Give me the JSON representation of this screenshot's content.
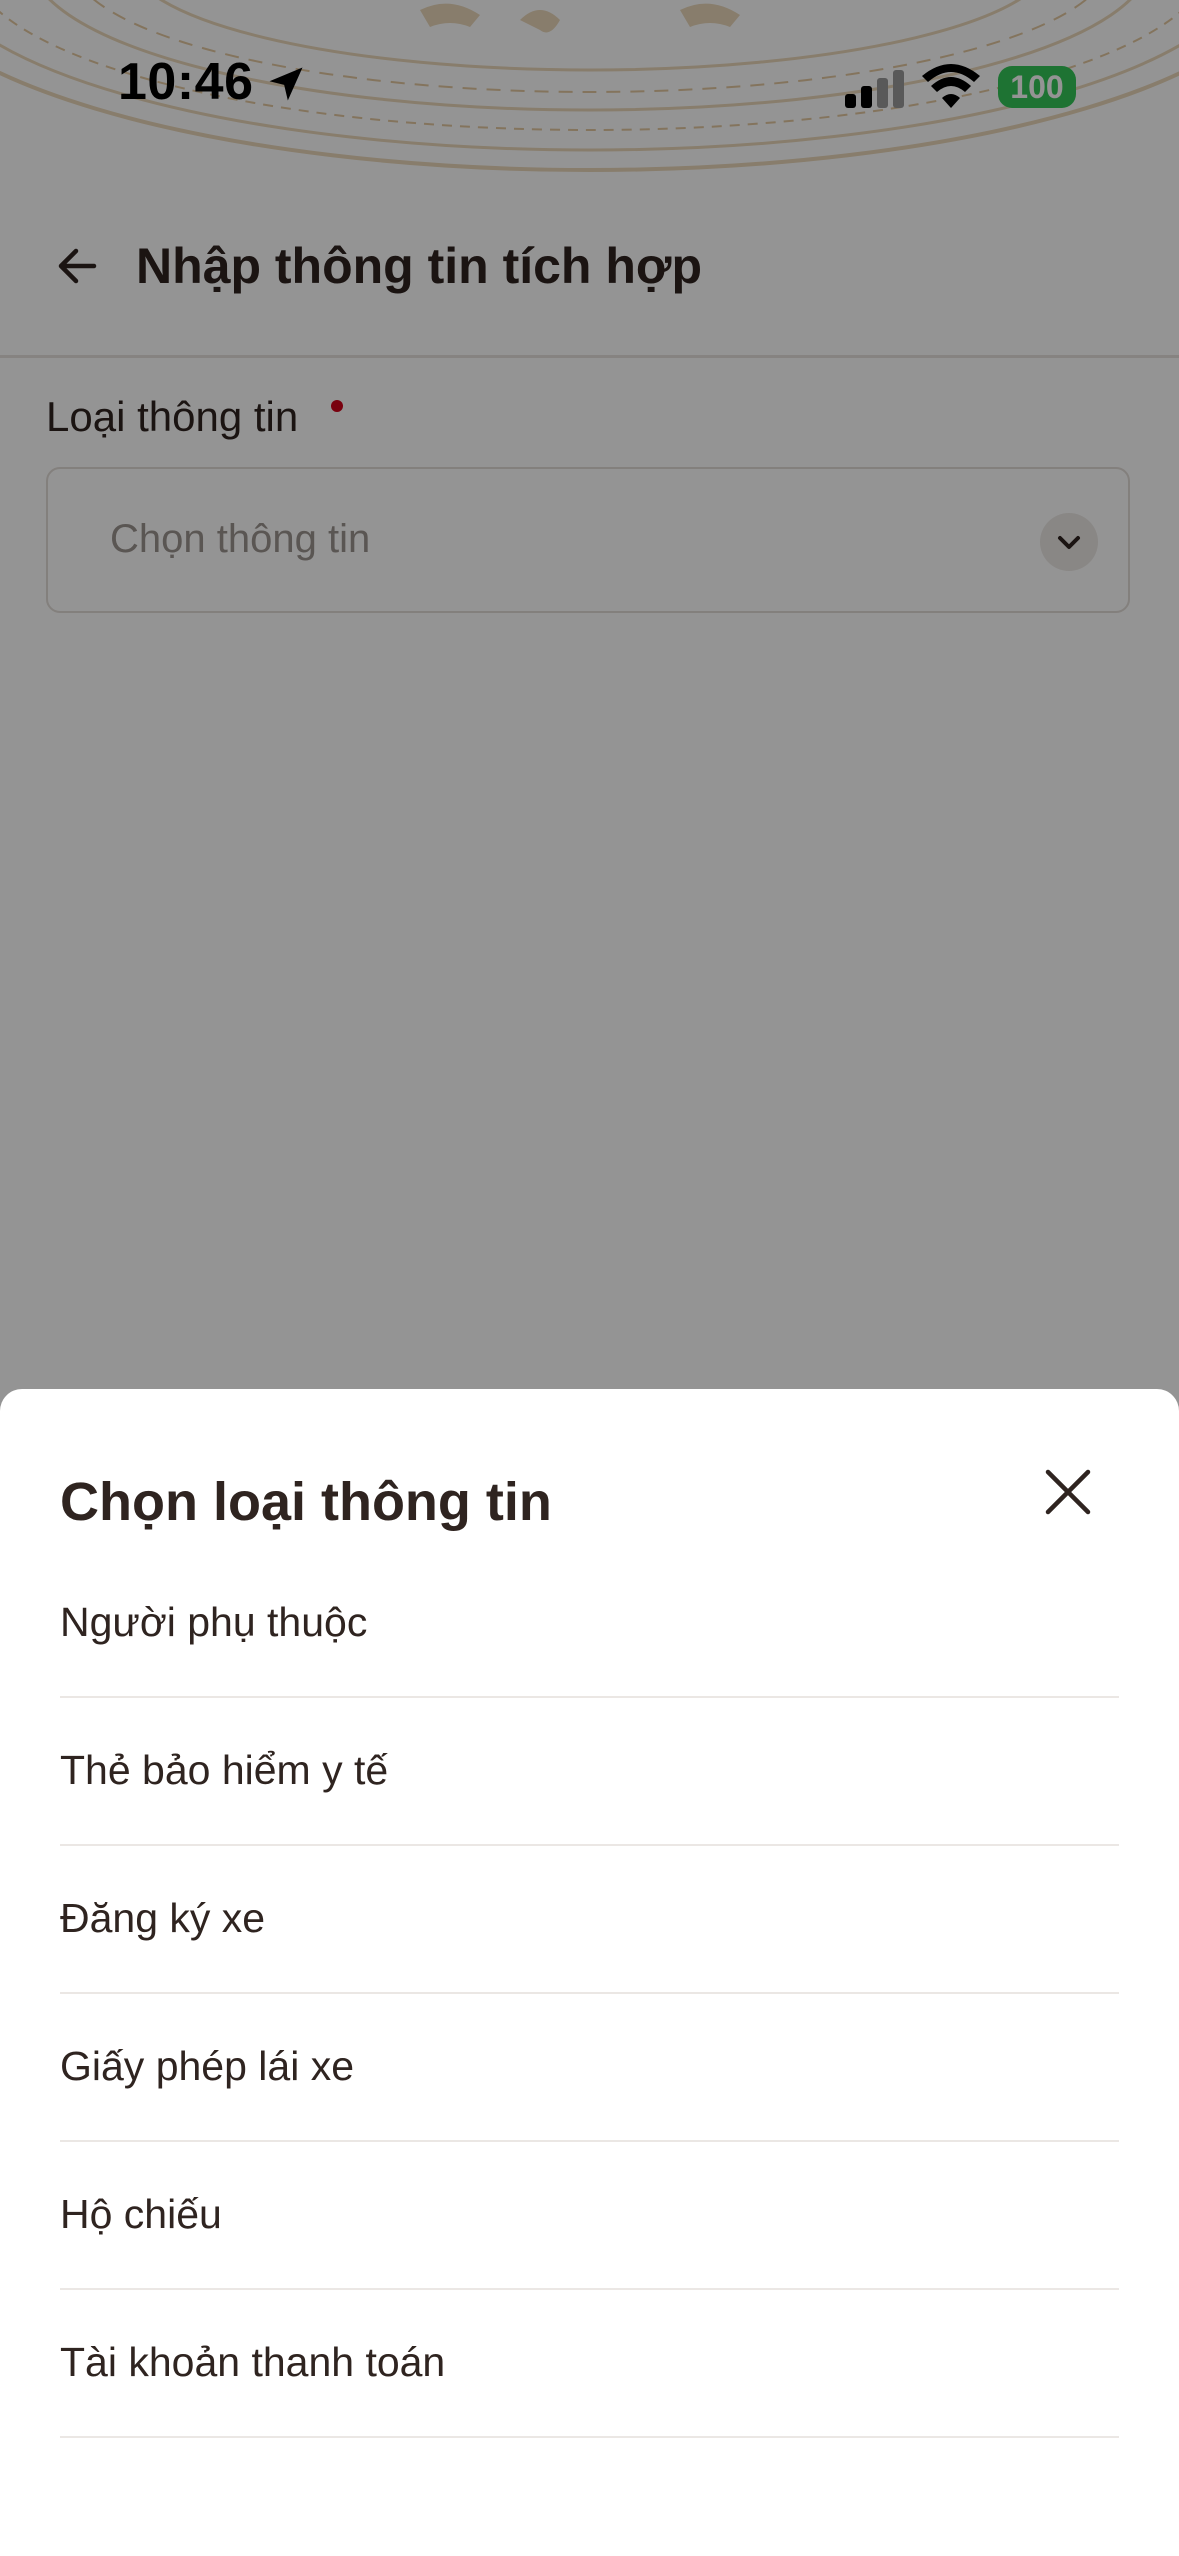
{
  "status_bar": {
    "time": "10:46",
    "battery": "100",
    "icons": [
      "location-arrow-icon",
      "cellular-signal-icon",
      "wifi-icon"
    ]
  },
  "nav": {
    "title": "Nhập thông tin tích hợp",
    "back_icon": "arrow-left-icon"
  },
  "form": {
    "field_label": "Loại thông tin",
    "required_color": "#d0021b",
    "select_placeholder": "Chọn thông tin",
    "select_icon": "chevron-down-icon"
  },
  "sheet": {
    "title": "Chọn loại thông tin",
    "close_icon": "close-icon",
    "options": [
      "Người phụ thuộc",
      "Thẻ bảo hiểm y tế",
      "Đăng ký xe",
      "Giấy phép lái xe",
      "Hộ chiếu",
      "Tài khoản thanh toán"
    ]
  },
  "colors": {
    "text_primary": "#2f2420",
    "battery_green": "#34c759",
    "header_pattern": "#e3c9a1"
  }
}
